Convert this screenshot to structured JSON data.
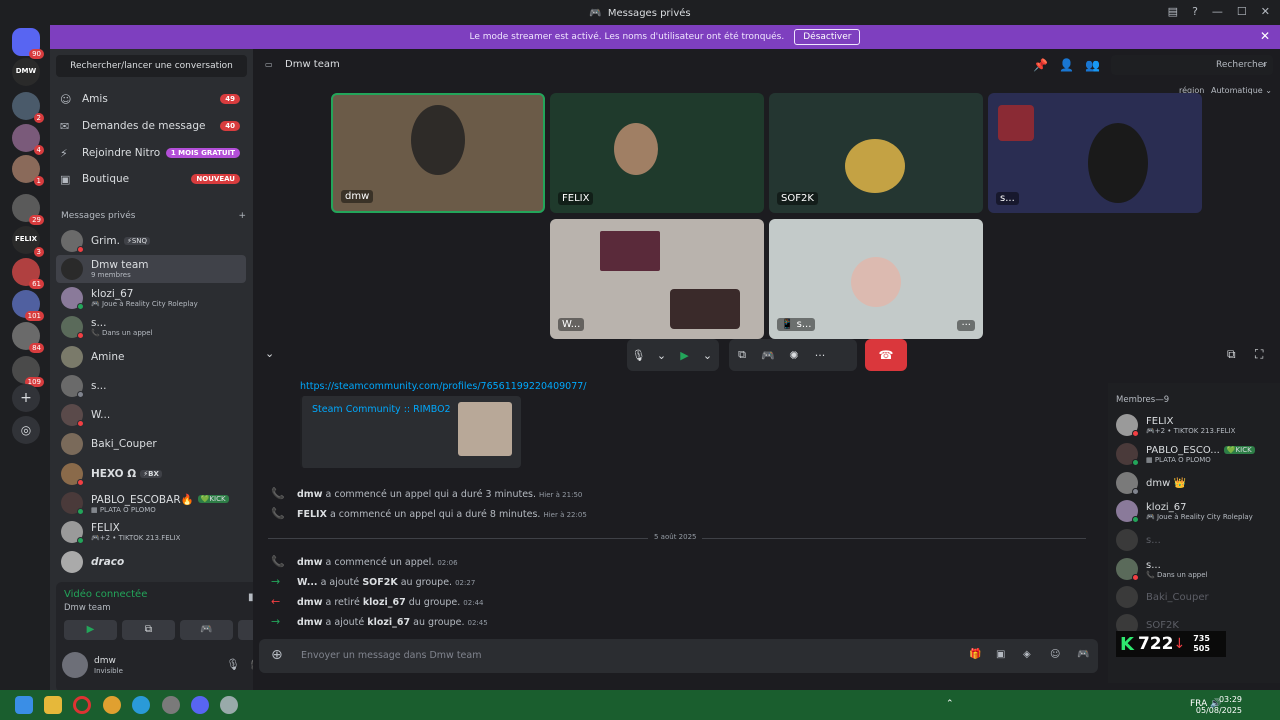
{
  "window": {
    "title": "Messages privés",
    "controls": [
      "—",
      "☐",
      "✕"
    ]
  },
  "banner": {
    "text": "Le mode streamer est activé. Les noms d'utilisateur ont été tronqués.",
    "button": "Désactiver"
  },
  "servers": [
    {
      "badge": "90",
      "kind": "discord"
    },
    {
      "badge": "",
      "text": "DMW"
    },
    {
      "badge": "2"
    },
    {
      "badge": "4"
    },
    {
      "badge": "1"
    },
    {
      "badge": "29"
    },
    {
      "badge": "3",
      "text": "FELIX"
    },
    {
      "badge": "61"
    },
    {
      "badge": "101"
    },
    {
      "badge": "84"
    },
    {
      "badge": "109"
    }
  ],
  "sidebar": {
    "search": "Rechercher/lancer une conversation",
    "nav": [
      {
        "label": "Amis",
        "icon": "☺",
        "pill": "49"
      },
      {
        "label": "Demandes de message",
        "icon": "✉",
        "pill": "40"
      },
      {
        "label": "Rejoindre Nitro",
        "icon": "⚡",
        "pill": "1 MOIS GRATUIT"
      },
      {
        "label": "Boutique",
        "icon": "▣",
        "pill": "NOUVEAU"
      }
    ],
    "section": "Messages privés",
    "section_add": "+",
    "dms": [
      {
        "name": "Grim.",
        "tag": "⚡SNQ",
        "sub": ""
      },
      {
        "name": "Dmw team",
        "tag": "",
        "sub": "9 membres"
      },
      {
        "name": "klozi_67",
        "tag": "",
        "sub": "🎮 Joue à Reality City Roleplay"
      },
      {
        "name": "s...",
        "tag": "",
        "sub": "📞 Dans un appel"
      },
      {
        "name": "Amine",
        "tag": "",
        "sub": ""
      },
      {
        "name": "s...",
        "tag": "",
        "sub": ""
      },
      {
        "name": "W...",
        "tag": "",
        "sub": ""
      },
      {
        "name": "Baki_Couper",
        "tag": "",
        "sub": ""
      },
      {
        "name": "HEXO Ω",
        "tag": "⚡BX",
        "sub": ""
      },
      {
        "name": "PABLO_ESCOBAR🔥",
        "tag": "💚KICK",
        "sub": "▦ PLATA O PLOMO"
      },
      {
        "name": "FELIX",
        "tag": "",
        "sub": "🎮+2 • TIKTOK 213.FELIX"
      },
      {
        "name": "draco",
        "tag": "",
        "sub": ""
      }
    ]
  },
  "voice": {
    "title": "Vidéo connectée",
    "channel": "Dmw team",
    "buttons": [
      "▶",
      "⧉",
      "🎮",
      "✺"
    ]
  },
  "user": {
    "name": "dmw",
    "status": "Invisible"
  },
  "channel": {
    "name": "Dmw team",
    "search_placeholder": "Rechercher",
    "region": "région",
    "quality": "Automatique ⌄"
  },
  "tiles": [
    {
      "label": "dmw"
    },
    {
      "label": "FELIX"
    },
    {
      "label": "SOF2K"
    },
    {
      "label": "s..."
    },
    {
      "label": "W..."
    },
    {
      "label": "📱 s..."
    }
  ],
  "tile_more": "···",
  "call_controls": {
    "mic": "🎙",
    "mic_menu": "⌄",
    "video": "▶",
    "video_menu": "⌄",
    "share": "⧉",
    "activity": "🎮",
    "soundboard": "✺",
    "more": "···",
    "hangup": "☎"
  },
  "chat": {
    "link": "https://steamcommunity.com/profiles/76561199220409077/",
    "embed_title": "Steam Community :: RIMBO2",
    "date_divider": "5 août 2025",
    "events": [
      {
        "icon": "📞",
        "user": "dmw",
        "text": "a commencé un appel qui a duré 3 minutes.",
        "target": "",
        "tail": "",
        "ts": "Hier à 21:50",
        "color": "green"
      },
      {
        "icon": "📞",
        "user": "FELIX",
        "text": "a commencé un appel qui a duré 8 minutes.",
        "target": "",
        "tail": "",
        "ts": "Hier à 22:05",
        "color": "green"
      },
      {
        "icon": "📞",
        "user": "dmw",
        "text": "a commencé un appel.",
        "target": "",
        "tail": "",
        "ts": "02:06",
        "color": "green"
      },
      {
        "icon": "→",
        "user": "W...",
        "text": "a ajouté",
        "target": "SOF2K",
        "tail": "au groupe.",
        "ts": "02:27",
        "color": "green"
      },
      {
        "icon": "←",
        "user": "dmw",
        "text": "a retiré",
        "target": "klozi_67",
        "tail": "du groupe.",
        "ts": "02:44",
        "color": "red"
      },
      {
        "icon": "→",
        "user": "dmw",
        "text": "a ajouté",
        "target": "klozi_67",
        "tail": "au groupe.",
        "ts": "02:45",
        "color": "green"
      }
    ],
    "composer_placeholder": "Envoyer un message dans Dmw team"
  },
  "members": {
    "header": "Membres—9",
    "list": [
      {
        "name": "FELIX",
        "tag": "",
        "sub": "🎮+2 • TIKTOK 213.FELIX",
        "status": "red"
      },
      {
        "name": "PABLO_ESCO...",
        "tag": "💚KICK",
        "sub": "▦ PLATA O PLOMO",
        "status": "green"
      },
      {
        "name": "dmw 👑",
        "tag": "",
        "sub": "",
        "status": "gray"
      },
      {
        "name": "klozi_67",
        "tag": "",
        "sub": "🎮 Joue à Reality City Roleplay",
        "status": "green"
      },
      {
        "name": "s...",
        "tag": "",
        "sub": "",
        "status": "gray",
        "off": true
      },
      {
        "name": "s...",
        "tag": "",
        "sub": "📞 Dans un appel",
        "status": "red"
      },
      {
        "name": "Baki_Couper",
        "tag": "",
        "sub": "",
        "status": "gray",
        "off": true
      },
      {
        "name": "SOF2K",
        "tag": "",
        "sub": "",
        "status": "gray",
        "off": true
      }
    ]
  },
  "overlay": {
    "k": "K",
    "count": "722",
    "arrow": "↓",
    "up": "735",
    "down": "505"
  },
  "taskbar": {
    "time": "03:29",
    "date": "05/08/2025",
    "lang": "FRA"
  }
}
